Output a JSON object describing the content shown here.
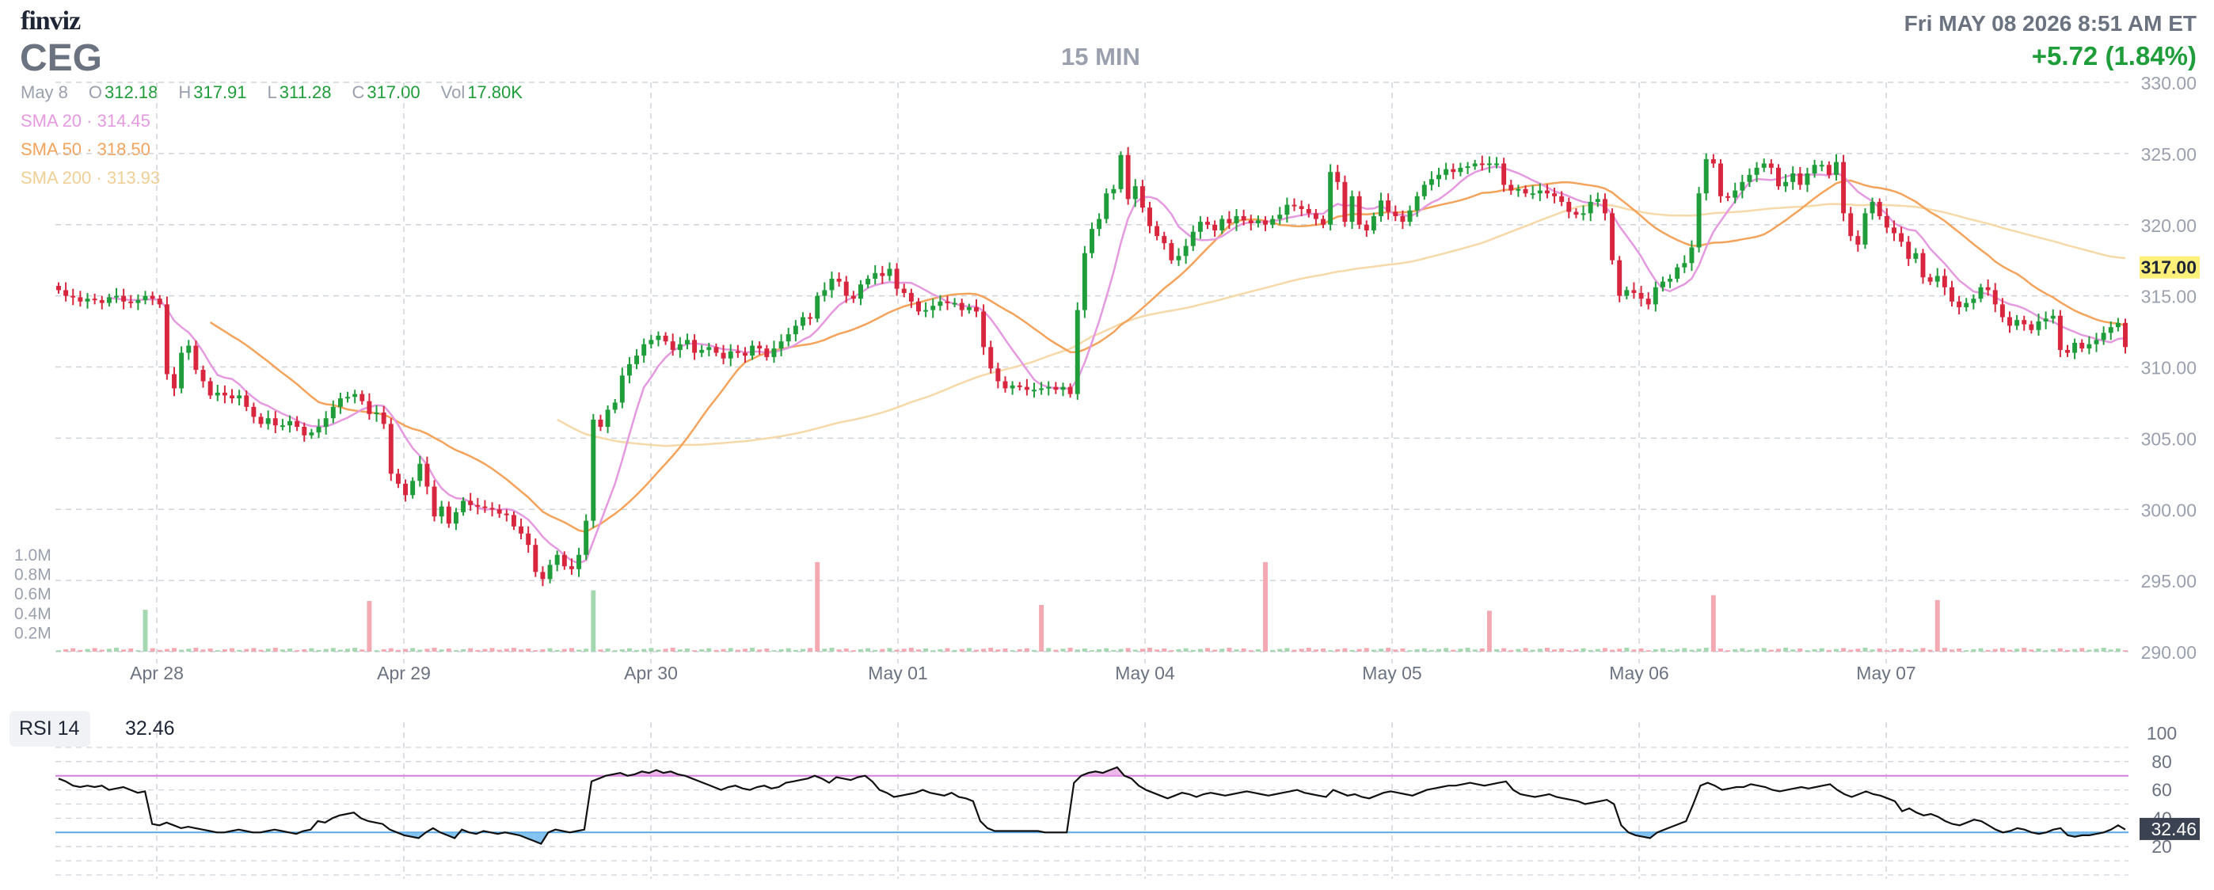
{
  "header": {
    "logo": "finviz",
    "ticker": "CEG",
    "timeframe": "15 MIN",
    "datetime": "Fri MAY 08 2026 8:51 AM ET",
    "change": "+5.72 (1.84%)"
  },
  "ohlc": {
    "date": "May 8",
    "open_label": "O",
    "open": "312.18",
    "high_label": "H",
    "high": "317.91",
    "low_label": "L",
    "low": "311.28",
    "close_label": "C",
    "close": "317.00",
    "volume_label": "Vol",
    "volume": "17.80K"
  },
  "indicators": [
    {
      "label": "SMA 20",
      "value": "314.45",
      "color": "#e59ae0"
    },
    {
      "label": "SMA 50",
      "value": "318.50",
      "color": "#f4a35b"
    },
    {
      "label": "SMA 200",
      "value": "313.93",
      "color": "#f5d9a8"
    }
  ],
  "colors": {
    "up": "#1f9d3a",
    "down": "#d7263d",
    "up_volume": "#a5d8b1",
    "down_volume": "#f2a9b2",
    "grid": "#cfd3da",
    "price_tag_bg": "#fff07a"
  },
  "rsi": {
    "label": "RSI 14",
    "value": "32.46",
    "overbought": 70,
    "oversold": 30,
    "ticks": [
      "100",
      "80",
      "60",
      "40",
      "20"
    ]
  },
  "chart_data": [
    {
      "type": "candlestick",
      "x_labels": [
        "Apr 28",
        "Apr 29",
        "Apr 30",
        "May 01",
        "May 04",
        "May 05",
        "May 06",
        "May 07"
      ],
      "y_ticks": [
        "330.00",
        "325.00",
        "320.00",
        "315.00",
        "310.00",
        "305.00",
        "300.00",
        "295.00",
        "290.00"
      ],
      "ylim": [
        290,
        330
      ],
      "last_price": "317.00",
      "closes": [
        315.4,
        315.0,
        314.9,
        314.6,
        314.8,
        314.7,
        314.5,
        314.9,
        315.0,
        314.6,
        314.5,
        314.7,
        315.0,
        314.8,
        314.4,
        309.5,
        308.5,
        311.0,
        311.5,
        309.8,
        309.0,
        308.0,
        308.2,
        308.0,
        307.8,
        308.0,
        307.2,
        306.5,
        306.0,
        306.4,
        305.9,
        305.9,
        306.2,
        305.8,
        305.2,
        305.4,
        305.8,
        306.4,
        307.2,
        307.8,
        307.9,
        308.1,
        307.6,
        306.7,
        306.8,
        306.0,
        302.5,
        301.8,
        301.0,
        302.0,
        303.2,
        301.6,
        299.5,
        300.2,
        299.0,
        299.8,
        300.6,
        300.3,
        300.2,
        300.1,
        300.0,
        299.7,
        299.6,
        298.8,
        298.3,
        297.5,
        295.6,
        295.1,
        296.1,
        296.8,
        296.0,
        295.8,
        296.8,
        299.2,
        306.3,
        305.8,
        307.0,
        307.5,
        309.4,
        310.2,
        310.8,
        311.6,
        311.9,
        312.2,
        311.8,
        311.2,
        311.6,
        311.9,
        311.0,
        311.2,
        311.4,
        311.0,
        310.6,
        311.1,
        311.0,
        310.8,
        311.5,
        311.3,
        310.7,
        311.3,
        311.8,
        312.3,
        312.9,
        313.5,
        313.4,
        315.0,
        315.4,
        316.2,
        316.0,
        315.0,
        314.8,
        315.8,
        316.2,
        316.6,
        316.4,
        316.9,
        315.5,
        315.2,
        314.6,
        313.9,
        314.0,
        314.3,
        314.6,
        314.5,
        314.5,
        314.0,
        314.2,
        313.9,
        311.4,
        309.9,
        309.0,
        308.5,
        308.7,
        308.6,
        308.4,
        308.4,
        308.5,
        308.6,
        308.4,
        308.6,
        308.1,
        314.0,
        318.0,
        319.7,
        320.4,
        322.2,
        322.5,
        324.9,
        321.8,
        322.7,
        321.2,
        319.9,
        319.2,
        318.7,
        317.5,
        317.8,
        318.5,
        319.5,
        320.2,
        320.0,
        319.6,
        320.4,
        320.1,
        320.6,
        320.3,
        320.1,
        320.3,
        320.0,
        320.4,
        320.7,
        321.4,
        321.3,
        321.1,
        320.8,
        320.4,
        320.0,
        323.7,
        323.0,
        320.2,
        322.0,
        320.0,
        319.6,
        320.6,
        321.7,
        320.9,
        320.6,
        320.2,
        321.0,
        322.0,
        322.8,
        323.2,
        323.5,
        323.9,
        323.7,
        324.0,
        324.1,
        324.3,
        324.2,
        324.3,
        324.3,
        322.8,
        322.4,
        322.5,
        322.2,
        322.2,
        322.4,
        322.2,
        322.0,
        321.6,
        320.9,
        320.7,
        320.8,
        321.6,
        321.8,
        320.8,
        317.5,
        315.0,
        315.4,
        315.2,
        314.8,
        314.4,
        315.6,
        316.0,
        316.2,
        317.0,
        317.3,
        318.4,
        322.2,
        324.6,
        324.3,
        322.0,
        321.9,
        322.4,
        323.0,
        323.5,
        324.0,
        324.3,
        324.0,
        322.7,
        323.0,
        323.6,
        322.8,
        323.6,
        324.2,
        324.2,
        323.5,
        324.4,
        320.8,
        319.2,
        318.6,
        320.8,
        321.6,
        320.6,
        319.8,
        319.4,
        318.8,
        317.6,
        318.0,
        316.3,
        316.0,
        316.4,
        315.6,
        314.6,
        314.2,
        314.5,
        314.8,
        315.6,
        315.4,
        314.4,
        313.5,
        312.9,
        313.3,
        313.0,
        312.6,
        313.2,
        313.4,
        313.6,
        311.2,
        311.0,
        311.7,
        311.3,
        311.6,
        311.9,
        312.4,
        312.8,
        313.1,
        311.4
      ],
      "volume_ticks": [
        "1.0M",
        "0.8M",
        "0.6M",
        "0.4M",
        "0.2M"
      ],
      "volume_spikes": [
        {
          "bar": 12,
          "value": 0.43,
          "color": "up"
        },
        {
          "bar": 43,
          "value": 0.52,
          "color": "down"
        },
        {
          "bar": 74,
          "value": 0.63,
          "color": "up"
        },
        {
          "bar": 105,
          "value": 0.92,
          "color": "down"
        },
        {
          "bar": 136,
          "value": 0.48,
          "color": "down"
        },
        {
          "bar": 167,
          "value": 0.92,
          "color": "down"
        },
        {
          "bar": 198,
          "value": 0.42,
          "color": "down"
        },
        {
          "bar": 229,
          "value": 0.58,
          "color": "down"
        },
        {
          "bar": 260,
          "value": 0.53,
          "color": "down"
        }
      ]
    },
    {
      "type": "line",
      "name": "RSI 14",
      "ylim": [
        0,
        100
      ],
      "values": [
        68,
        66,
        63,
        62,
        63,
        62,
        63,
        60,
        61,
        62,
        60,
        58,
        59,
        36,
        35,
        37,
        35,
        33,
        34,
        33,
        32,
        31,
        30,
        30,
        31,
        32,
        31,
        30,
        30,
        31,
        32,
        31,
        30,
        29,
        31,
        32,
        38,
        37,
        40,
        42,
        43,
        44,
        40,
        38,
        37,
        36,
        32,
        30,
        28,
        27,
        26,
        30,
        33,
        30,
        28,
        26,
        32,
        30,
        29,
        31,
        30,
        29,
        30,
        29,
        28,
        26,
        24,
        22,
        30,
        32,
        31,
        30,
        31,
        32,
        66,
        68,
        70,
        71,
        72,
        70,
        71,
        73,
        72,
        74,
        72,
        73,
        71,
        70,
        68,
        66,
        64,
        62,
        60,
        62,
        63,
        61,
        60,
        62,
        63,
        61,
        62,
        65,
        66,
        67,
        68,
        70,
        68,
        65,
        69,
        68,
        67,
        69,
        70,
        66,
        60,
        58,
        55,
        56,
        57,
        58,
        60,
        58,
        57,
        56,
        58,
        55,
        54,
        52,
        38,
        33,
        31,
        31,
        31,
        31,
        31,
        31,
        31,
        30,
        30,
        30,
        30,
        65,
        70,
        72,
        73,
        72,
        74,
        76,
        70,
        68,
        63,
        60,
        58,
        56,
        54,
        56,
        58,
        57,
        55,
        57,
        58,
        57,
        56,
        57,
        58,
        59,
        58,
        57,
        56,
        57,
        58,
        59,
        60,
        58,
        57,
        56,
        55,
        60,
        58,
        56,
        57,
        55,
        54,
        56,
        58,
        59,
        58,
        57,
        56,
        58,
        60,
        61,
        62,
        63,
        63,
        64,
        65,
        64,
        63,
        64,
        65,
        66,
        60,
        57,
        56,
        55,
        56,
        57,
        55,
        54,
        53,
        52,
        50,
        51,
        52,
        53,
        50,
        35,
        30,
        28,
        27,
        26,
        30,
        32,
        34,
        36,
        38,
        50,
        63,
        65,
        63,
        60,
        61,
        62,
        62,
        64,
        63,
        62,
        60,
        59,
        60,
        61,
        62,
        61,
        62,
        63,
        64,
        60,
        57,
        55,
        57,
        59,
        57,
        56,
        54,
        52,
        45,
        47,
        44,
        42,
        43,
        41,
        38,
        36,
        35,
        37,
        39,
        38,
        35,
        32,
        30,
        31,
        33,
        32,
        30,
        29,
        30,
        32,
        33,
        28,
        27,
        28,
        28,
        29,
        30,
        32,
        35,
        32
      ]
    }
  ]
}
